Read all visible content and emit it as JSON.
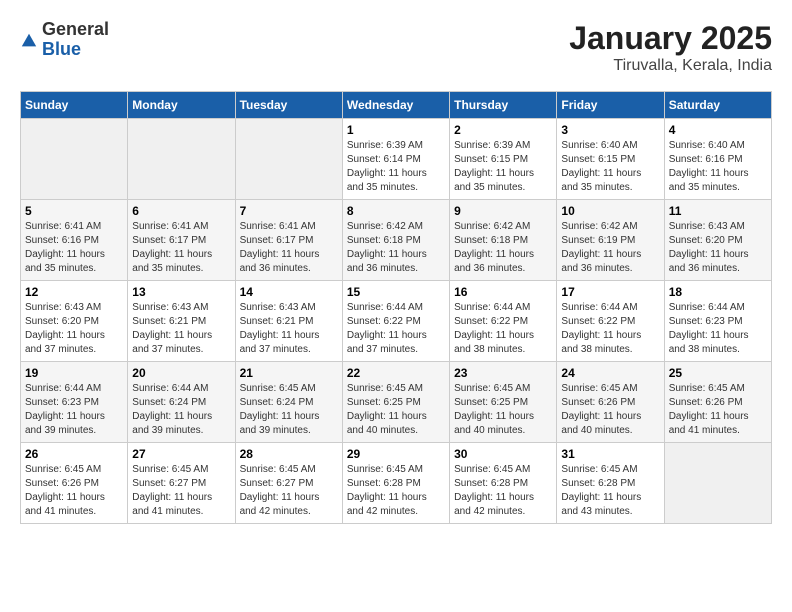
{
  "header": {
    "logo_general": "General",
    "logo_blue": "Blue",
    "title": "January 2025",
    "subtitle": "Tiruvalla, Kerala, India"
  },
  "weekdays": [
    "Sunday",
    "Monday",
    "Tuesday",
    "Wednesday",
    "Thursday",
    "Friday",
    "Saturday"
  ],
  "weeks": [
    [
      {
        "day": "",
        "info": ""
      },
      {
        "day": "",
        "info": ""
      },
      {
        "day": "",
        "info": ""
      },
      {
        "day": "1",
        "info": "Sunrise: 6:39 AM\nSunset: 6:14 PM\nDaylight: 11 hours\nand 35 minutes."
      },
      {
        "day": "2",
        "info": "Sunrise: 6:39 AM\nSunset: 6:15 PM\nDaylight: 11 hours\nand 35 minutes."
      },
      {
        "day": "3",
        "info": "Sunrise: 6:40 AM\nSunset: 6:15 PM\nDaylight: 11 hours\nand 35 minutes."
      },
      {
        "day": "4",
        "info": "Sunrise: 6:40 AM\nSunset: 6:16 PM\nDaylight: 11 hours\nand 35 minutes."
      }
    ],
    [
      {
        "day": "5",
        "info": "Sunrise: 6:41 AM\nSunset: 6:16 PM\nDaylight: 11 hours\nand 35 minutes."
      },
      {
        "day": "6",
        "info": "Sunrise: 6:41 AM\nSunset: 6:17 PM\nDaylight: 11 hours\nand 35 minutes."
      },
      {
        "day": "7",
        "info": "Sunrise: 6:41 AM\nSunset: 6:17 PM\nDaylight: 11 hours\nand 36 minutes."
      },
      {
        "day": "8",
        "info": "Sunrise: 6:42 AM\nSunset: 6:18 PM\nDaylight: 11 hours\nand 36 minutes."
      },
      {
        "day": "9",
        "info": "Sunrise: 6:42 AM\nSunset: 6:18 PM\nDaylight: 11 hours\nand 36 minutes."
      },
      {
        "day": "10",
        "info": "Sunrise: 6:42 AM\nSunset: 6:19 PM\nDaylight: 11 hours\nand 36 minutes."
      },
      {
        "day": "11",
        "info": "Sunrise: 6:43 AM\nSunset: 6:20 PM\nDaylight: 11 hours\nand 36 minutes."
      }
    ],
    [
      {
        "day": "12",
        "info": "Sunrise: 6:43 AM\nSunset: 6:20 PM\nDaylight: 11 hours\nand 37 minutes."
      },
      {
        "day": "13",
        "info": "Sunrise: 6:43 AM\nSunset: 6:21 PM\nDaylight: 11 hours\nand 37 minutes."
      },
      {
        "day": "14",
        "info": "Sunrise: 6:43 AM\nSunset: 6:21 PM\nDaylight: 11 hours\nand 37 minutes."
      },
      {
        "day": "15",
        "info": "Sunrise: 6:44 AM\nSunset: 6:22 PM\nDaylight: 11 hours\nand 37 minutes."
      },
      {
        "day": "16",
        "info": "Sunrise: 6:44 AM\nSunset: 6:22 PM\nDaylight: 11 hours\nand 38 minutes."
      },
      {
        "day": "17",
        "info": "Sunrise: 6:44 AM\nSunset: 6:22 PM\nDaylight: 11 hours\nand 38 minutes."
      },
      {
        "day": "18",
        "info": "Sunrise: 6:44 AM\nSunset: 6:23 PM\nDaylight: 11 hours\nand 38 minutes."
      }
    ],
    [
      {
        "day": "19",
        "info": "Sunrise: 6:44 AM\nSunset: 6:23 PM\nDaylight: 11 hours\nand 39 minutes."
      },
      {
        "day": "20",
        "info": "Sunrise: 6:44 AM\nSunset: 6:24 PM\nDaylight: 11 hours\nand 39 minutes."
      },
      {
        "day": "21",
        "info": "Sunrise: 6:45 AM\nSunset: 6:24 PM\nDaylight: 11 hours\nand 39 minutes."
      },
      {
        "day": "22",
        "info": "Sunrise: 6:45 AM\nSunset: 6:25 PM\nDaylight: 11 hours\nand 40 minutes."
      },
      {
        "day": "23",
        "info": "Sunrise: 6:45 AM\nSunset: 6:25 PM\nDaylight: 11 hours\nand 40 minutes."
      },
      {
        "day": "24",
        "info": "Sunrise: 6:45 AM\nSunset: 6:26 PM\nDaylight: 11 hours\nand 40 minutes."
      },
      {
        "day": "25",
        "info": "Sunrise: 6:45 AM\nSunset: 6:26 PM\nDaylight: 11 hours\nand 41 minutes."
      }
    ],
    [
      {
        "day": "26",
        "info": "Sunrise: 6:45 AM\nSunset: 6:26 PM\nDaylight: 11 hours\nand 41 minutes."
      },
      {
        "day": "27",
        "info": "Sunrise: 6:45 AM\nSunset: 6:27 PM\nDaylight: 11 hours\nand 41 minutes."
      },
      {
        "day": "28",
        "info": "Sunrise: 6:45 AM\nSunset: 6:27 PM\nDaylight: 11 hours\nand 42 minutes."
      },
      {
        "day": "29",
        "info": "Sunrise: 6:45 AM\nSunset: 6:28 PM\nDaylight: 11 hours\nand 42 minutes."
      },
      {
        "day": "30",
        "info": "Sunrise: 6:45 AM\nSunset: 6:28 PM\nDaylight: 11 hours\nand 42 minutes."
      },
      {
        "day": "31",
        "info": "Sunrise: 6:45 AM\nSunset: 6:28 PM\nDaylight: 11 hours\nand 43 minutes."
      },
      {
        "day": "",
        "info": ""
      }
    ]
  ]
}
